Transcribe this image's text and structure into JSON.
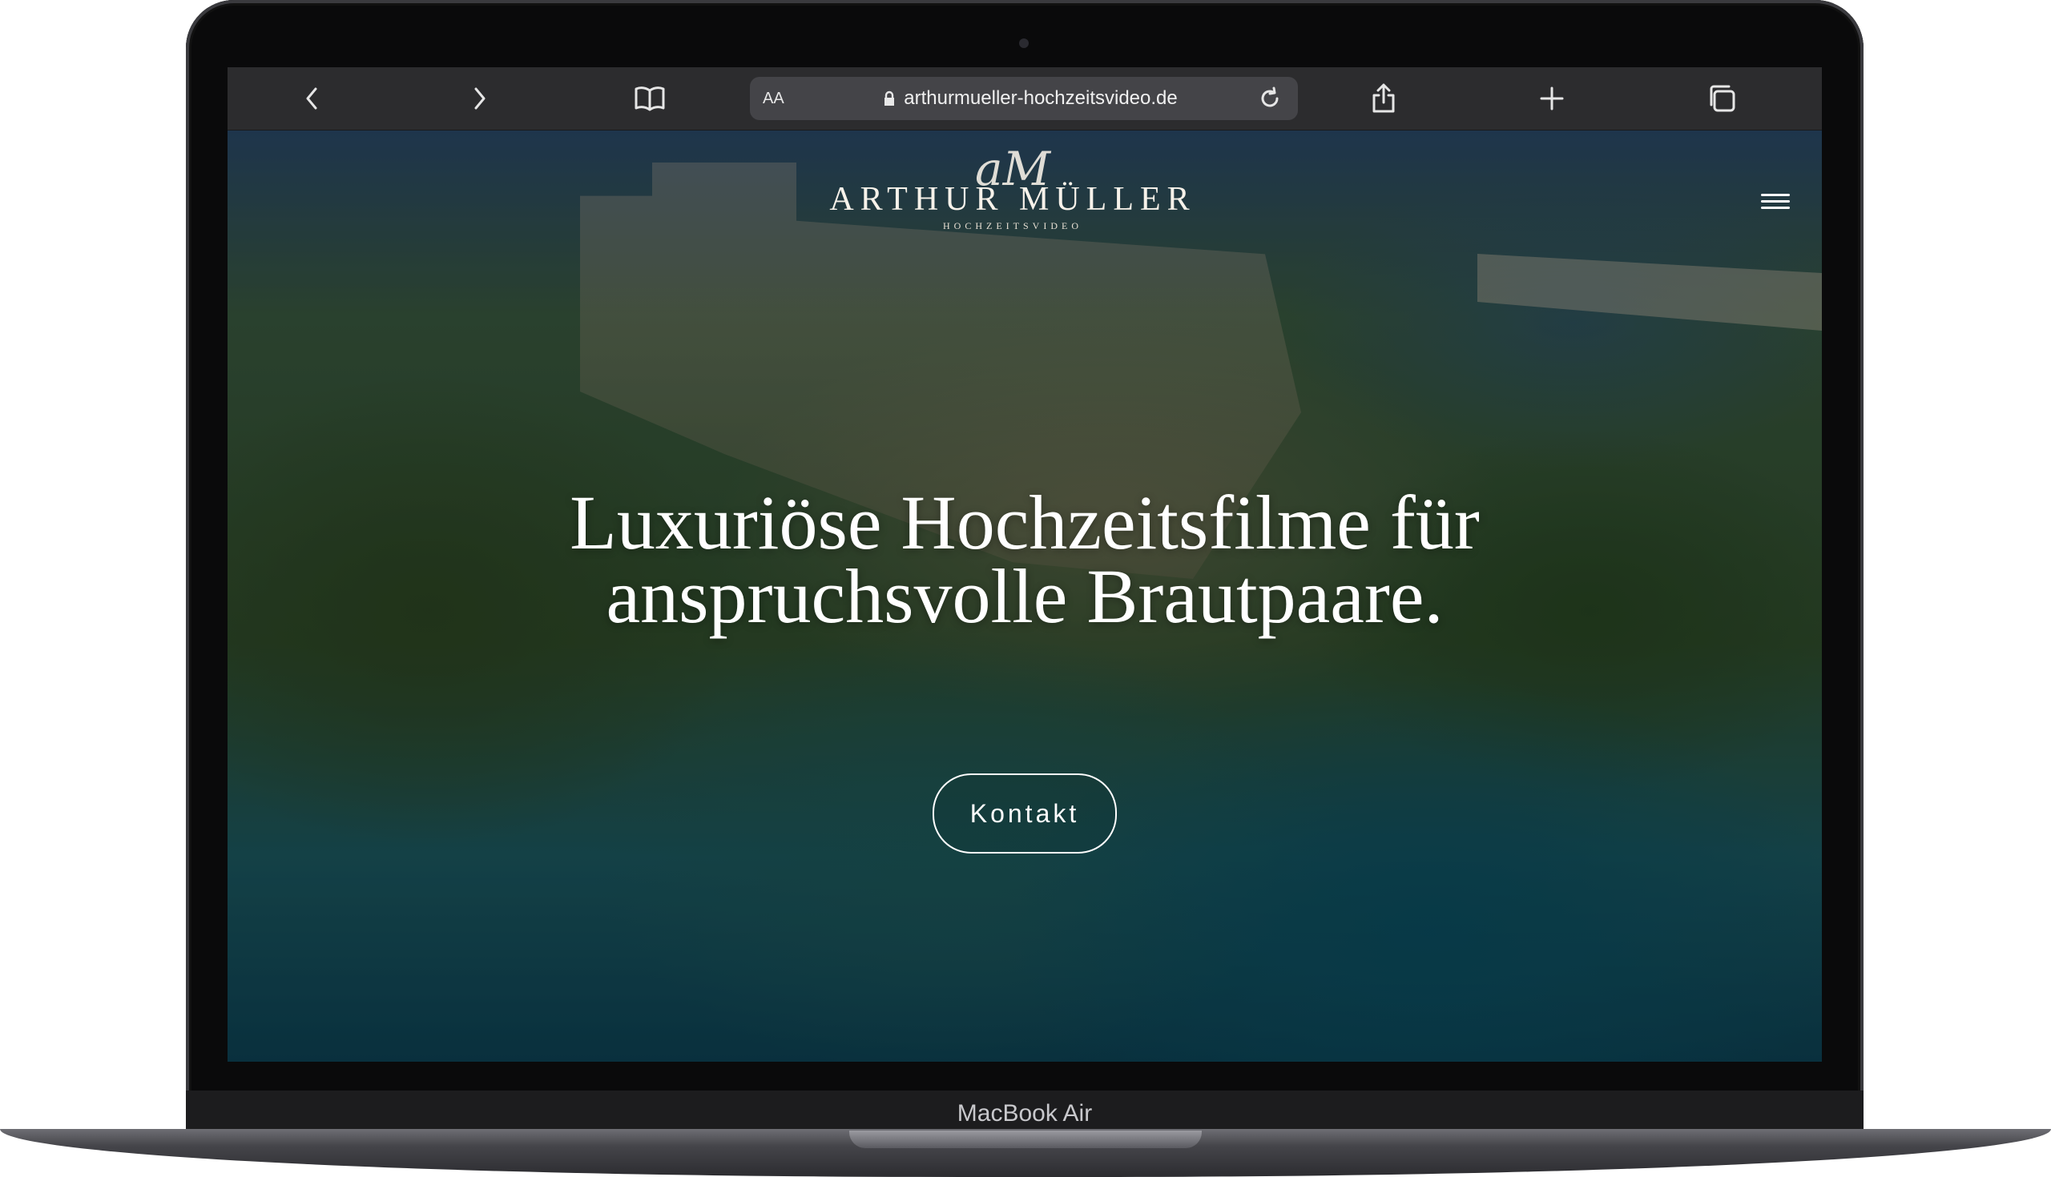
{
  "device": {
    "model_label": "MacBook Air"
  },
  "browser": {
    "reader_label": "AA",
    "url": "arthurmueller-hochzeitsvideo.de",
    "icons": [
      "chevron-left-icon",
      "chevron-right-icon",
      "book-icon",
      "lock-icon",
      "reload-icon",
      "share-icon",
      "plus-icon",
      "tabs-icon"
    ]
  },
  "site": {
    "logo_monogram": "aM",
    "logo_name": "ARTHUR MÜLLER",
    "logo_sub": "HOCHZEITSVIDEO",
    "headline_line1": "Luxuriöse Hochzeitsfilme für",
    "headline_line2": "anspruchsvolle Brautpaare.",
    "cta_label": "Kontakt",
    "menu_icon": "hamburger-menu-icon"
  }
}
